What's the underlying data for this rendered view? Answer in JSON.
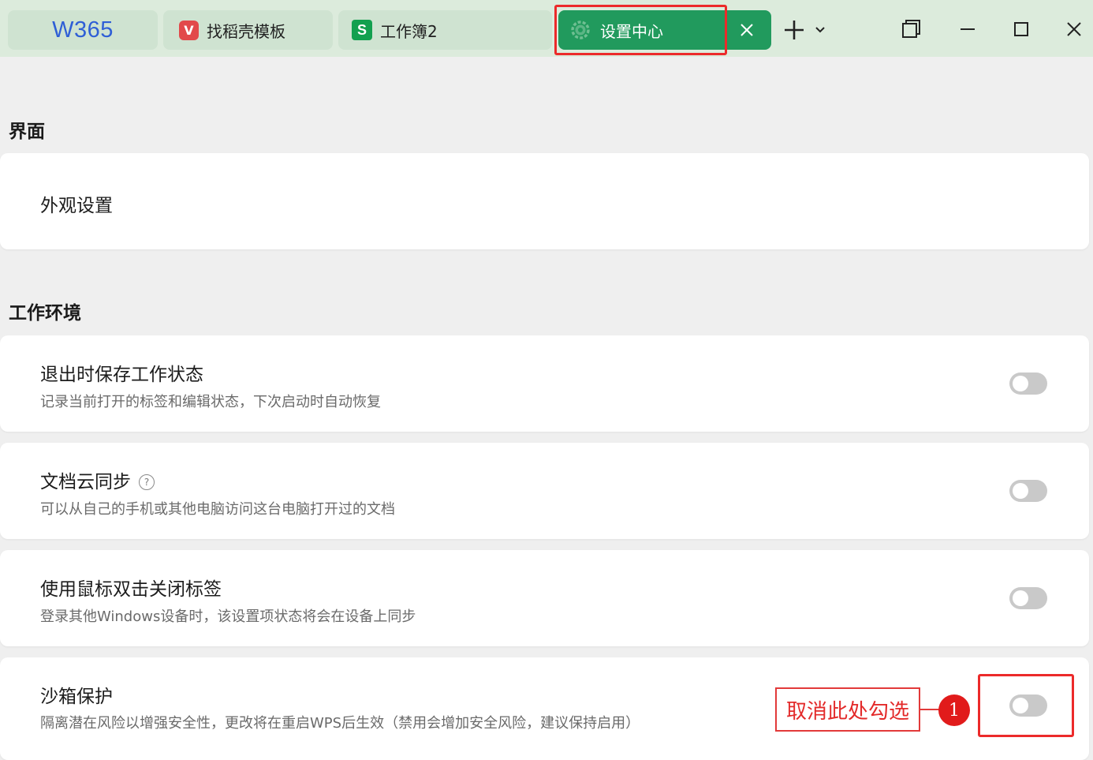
{
  "tabs": {
    "home": {
      "logo": "W365"
    },
    "daoke": {
      "label": "找稻壳模板",
      "icon_char": "V"
    },
    "workbook": {
      "label": "工作簿2",
      "icon_char": "S"
    },
    "settings": {
      "label": "设置中心"
    }
  },
  "sections": {
    "interface": {
      "title": "界面",
      "items": {
        "appearance": {
          "title": "外观设置"
        }
      }
    },
    "workspace": {
      "title": "工作环境",
      "items": {
        "save_state": {
          "title": "退出时保存工作状态",
          "desc": "记录当前打开的标签和编辑状态，下次启动时自动恢复",
          "enabled": false
        },
        "cloud_sync": {
          "title": "文档云同步",
          "desc": "可以从自己的手机或其他电脑访问这台电脑打开过的文档",
          "help_glyph": "?",
          "enabled": false
        },
        "dblclick_close": {
          "title": "使用鼠标双击关闭标签",
          "desc": "登录其他Windows设备时，该设置项状态将会在设备上同步",
          "enabled": false
        },
        "sandbox": {
          "title": "沙箱保护",
          "desc": "隔离潜在风险以增强安全性，更改将在重启WPS后生效（禁用会增加安全风险，建议保持启用）",
          "enabled": false
        }
      }
    }
  },
  "annotation": {
    "label": "取消此处勾选",
    "number": "1"
  },
  "colors": {
    "tabbar_bg": "#dcebdc",
    "tab_bg": "#cfe3d1",
    "active_tab": "#219a5d",
    "highlight_red": "#ec2a2a",
    "toggle_off": "#c9c9c9"
  }
}
